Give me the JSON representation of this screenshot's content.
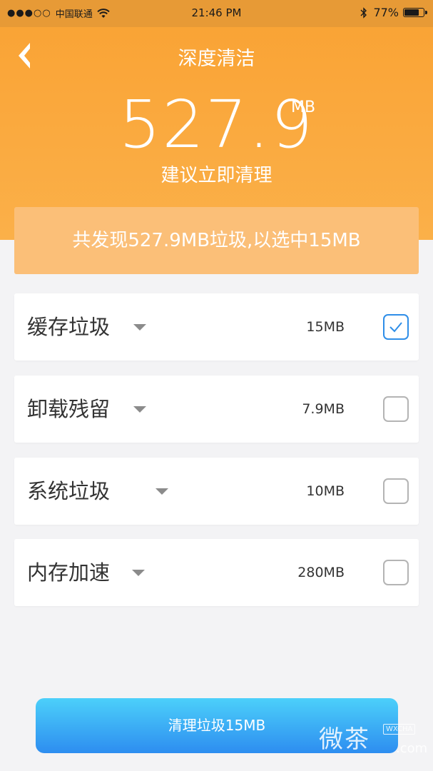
{
  "status_bar": {
    "signal": "●●●○○",
    "carrier": "中国联通",
    "wifi_icon": "wifi-icon",
    "time": "21:46 PM",
    "bluetooth_icon": "bluetooth-icon",
    "battery_percent": "77%",
    "battery_level": 0.77
  },
  "header": {
    "title": "深度清洁",
    "size_value": "527.9",
    "size_unit": "MB",
    "suggestion": "建议立即清理"
  },
  "summary": {
    "text": "共发现527.9MB垃圾,以选中15MB"
  },
  "items": [
    {
      "label": "缓存垃圾",
      "size": "15MB",
      "checked": true
    },
    {
      "label": "卸载残留",
      "size": "7.9MB",
      "checked": false
    },
    {
      "label": "系统垃圾",
      "size": "10MB",
      "checked": false
    },
    {
      "label": "内存加速",
      "size": "280MB",
      "checked": false
    }
  ],
  "clean_button": {
    "label": "清理垃圾15MB"
  },
  "watermark": {
    "text": "微茶",
    "tag": "WXCHA",
    "domain": ".com"
  },
  "colors": {
    "header_orange": "#f9a233",
    "summary_orange": "#fbbf78",
    "check_blue": "#2f8ee8",
    "button_blue_top": "#4cd0fa",
    "button_blue_bottom": "#2d8df0"
  }
}
